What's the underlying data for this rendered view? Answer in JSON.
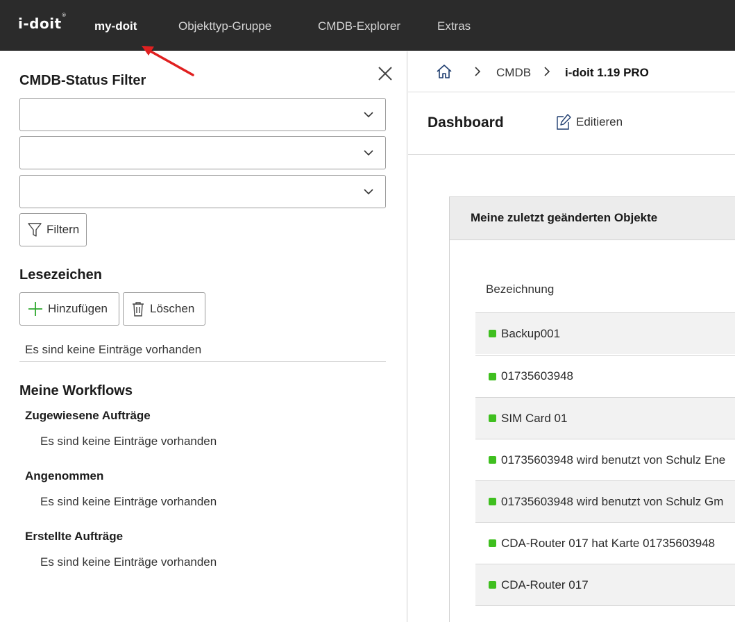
{
  "topbar": {
    "logo": "i-doit",
    "logo_mark": "®",
    "nav": [
      {
        "label": "my-doit",
        "active": true
      },
      {
        "label": "Objekttyp-Gruppe",
        "active": false
      },
      {
        "label": "CMDB-Explorer",
        "active": false
      },
      {
        "label": "Extras",
        "active": false
      }
    ]
  },
  "left_panel": {
    "cmdb_filter": {
      "title": "CMDB-Status Filter",
      "selects": [
        "",
        "",
        ""
      ],
      "filter_button": "Filtern"
    },
    "bookmarks": {
      "title": "Lesezeichen",
      "add_button": "Hinzufügen",
      "delete_button": "Löschen",
      "empty": "Es sind keine Einträge vorhanden"
    },
    "workflows": {
      "title": "Meine Workflows",
      "groups": [
        {
          "title": "Zugewiesene Aufträge",
          "empty": "Es sind keine Einträge vorhanden"
        },
        {
          "title": "Angenommen",
          "empty": "Es sind keine Einträge vorhanden"
        },
        {
          "title": "Erstellte Aufträge",
          "empty": "Es sind keine Einträge vorhanden"
        }
      ]
    }
  },
  "breadcrumb": {
    "items": [
      "CMDB",
      "i-doit 1.19 PRO"
    ]
  },
  "dashboard": {
    "title": "Dashboard",
    "edit_label": "Editieren"
  },
  "widget": {
    "title": "Meine zuletzt geänderten Objekte",
    "column_header": "Bezeichnung",
    "rows": [
      {
        "label": "Backup001",
        "status_color": "#3fbf1f"
      },
      {
        "label": "01735603948",
        "status_color": "#3fbf1f"
      },
      {
        "label": "SIM Card 01",
        "status_color": "#3fbf1f"
      },
      {
        "label": "01735603948 wird benutzt von Schulz Ene",
        "status_color": "#3fbf1f"
      },
      {
        "label": "01735603948 wird benutzt von Schulz Gm",
        "status_color": "#3fbf1f"
      },
      {
        "label": "CDA-Router 017 hat Karte 01735603948",
        "status_color": "#3fbf1f"
      },
      {
        "label": "CDA-Router 017",
        "status_color": "#3fbf1f"
      }
    ]
  },
  "colors": {
    "topbar_bg": "#2b2b2b",
    "status_green": "#3fbf1f",
    "annotation_red": "#e02020",
    "filter_icon": "funnel-icon",
    "add_icon_color": "#2ea82e"
  }
}
